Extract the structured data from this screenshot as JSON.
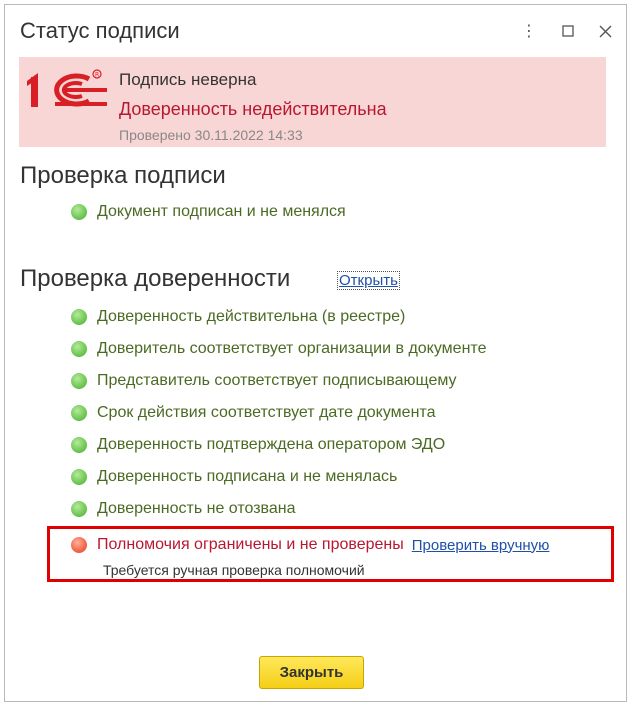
{
  "window": {
    "title": "Статус подписи",
    "controls": {
      "more": "⋮",
      "maximize": "☐",
      "close": "✕"
    }
  },
  "banner": {
    "logo": "1С",
    "status": "Подпись неверна",
    "reason": "Доверенность недействительна",
    "checked": "Проверено 30.11.2022 14:33",
    "background_color": "#f9d6d6",
    "error_color": "#b8172f"
  },
  "signature_check": {
    "title": "Проверка подписи",
    "items": [
      {
        "text": "Документ подписан и не менялся",
        "status": "ok"
      }
    ]
  },
  "poa_check": {
    "title": "Проверка доверенности",
    "open_link": "Открыть",
    "items": [
      {
        "text": "Доверенность действительна (в реестре)",
        "status": "ok"
      },
      {
        "text": "Доверитель соответствует организации в документе",
        "status": "ok"
      },
      {
        "text": "Представитель соответствует подписывающему",
        "status": "ok"
      },
      {
        "text": "Срок действия соответствует дате документа",
        "status": "ok"
      },
      {
        "text": "Доверенность подтверждена оператором ЭДО",
        "status": "ok"
      },
      {
        "text": "Доверенность подписана и не менялась",
        "status": "ok"
      },
      {
        "text": "Доверенность не отозвана",
        "status": "ok"
      }
    ],
    "warning": {
      "text": "Полномочия ограничены и не проверены",
      "link": "Проверить вручную",
      "subtext": "Требуется ручная проверка полномочий",
      "status": "error",
      "highlight_color": "#e10000"
    }
  },
  "footer": {
    "close_button": "Закрыть"
  }
}
